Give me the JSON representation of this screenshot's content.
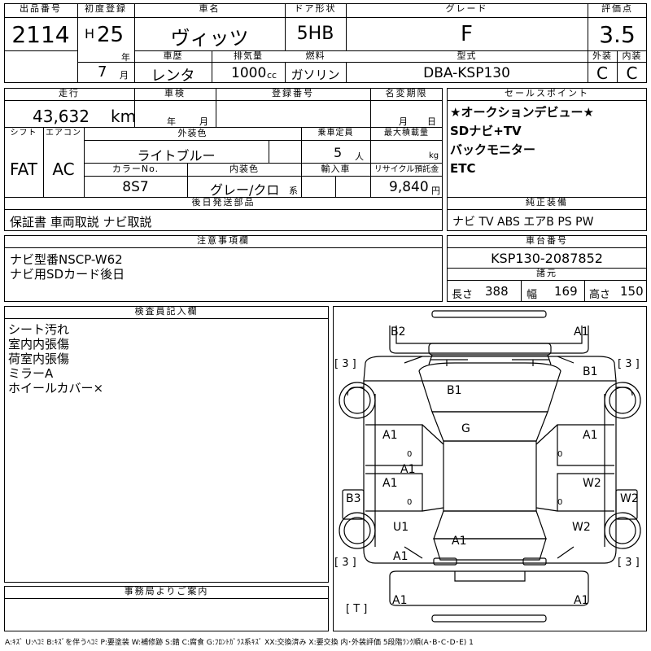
{
  "labels": {
    "lot_no": "出品番号",
    "first_reg": "初度登録",
    "car_name": "車名",
    "door": "ドア形状",
    "grade": "グレード",
    "score": "評価点",
    "history": "車歴",
    "displacement": "排気量",
    "fuel": "燃料",
    "model": "型式",
    "exterior": "外装",
    "interior": "内装",
    "mileage": "走行",
    "inspection": "車検",
    "reg_no": "登録番号",
    "name_change": "名変期限",
    "sales_point": "セールスポイント",
    "shift": "シフト",
    "aircon": "エアコン",
    "ext_color": "外装色",
    "capacity": "乗車定員",
    "max_load": "最大積載量",
    "color_no": "カラーNo.",
    "int_color": "内装色",
    "import": "輸入車",
    "recycle": "リサイクル預託金",
    "later_parts": "後日発送部品",
    "genuine": "純正装備",
    "notes": "注意事項欄",
    "chassis": "車台番号",
    "specs": "諸元",
    "length": "長さ",
    "width": "幅",
    "height": "高さ",
    "inspector": "検査員記入欄",
    "office": "事務局よりご案内",
    "year_unit": "年",
    "month_unit": "月",
    "km_unit": "km",
    "cc_unit": "cc",
    "person_unit": "人",
    "kg_unit": "kg",
    "yen_unit": "円",
    "kei_unit": "系",
    "h_prefix": "H",
    "insp_year": "年",
    "insp_month": "月",
    "nc_month": "月",
    "nc_day": "日"
  },
  "lot_no": "2114",
  "first_reg_year": "25",
  "first_reg_month": "7",
  "car_name": "ヴィッツ",
  "door": "5HB",
  "grade": "F",
  "score": "3.5",
  "history": "レンタ",
  "displacement": "1000",
  "fuel": "ガソリン",
  "model": "DBA-KSP130",
  "exterior_grade": "C",
  "interior_grade": "C",
  "mileage": "43,632",
  "shift": "FAT",
  "aircon": "AC",
  "ext_color": "ライトブルー",
  "capacity": "5",
  "color_no": "8S7",
  "int_color": "グレー/クロ",
  "recycle": "9,840",
  "sales_points": [
    "★オークションデビュー★",
    "SDナビ+TV",
    "バックモニター",
    "ETC"
  ],
  "later_parts": "保証書 車両取説 ナビ取説",
  "genuine": "ナビ TV ABS エアB PS PW",
  "notes": [
    "ナビ型番NSCP-W62",
    "ナビ用SDカード後日"
  ],
  "chassis": "KSP130-2087852",
  "length": "388",
  "width": "169",
  "height": "150",
  "inspector_notes": [
    "シート汚れ",
    "室内内張傷",
    "荷室内張傷",
    "ミラーA",
    "ホイールカバー×"
  ],
  "car_marks": {
    "b2": "B2",
    "a1_front": "A1",
    "b1_hood": "B1",
    "b1_right": "B1",
    "g": "G",
    "a1_lf": "A1",
    "a1_rf": "A1",
    "a1_center": "A1",
    "a1_lr": "A1",
    "w2_r": "W2",
    "w2_edge": "W2",
    "b3": "B3",
    "u1": "U1",
    "w2_rr": "W2",
    "a1_roof": "A1",
    "a1_lq": "A1",
    "a1_rear_l": "A1",
    "a1_rear_r": "A1",
    "bracket_lf": "[ 3 ]",
    "bracket_rf": "[ 3 ]",
    "bracket_lr": "[ 3 ]",
    "bracket_rr": "[ 3 ]",
    "t": "[ T ]",
    "zero1": "0",
    "zero2": "0",
    "zero3": "0",
    "zero4": "0"
  },
  "legend": "A:ｷｽﾞ U:ﾍｺﾐ B:ｷｽﾞを伴うﾍｺﾐ P:要塗装 W:補修跡 S:錆 C:腐食 G:ﾌﾛﾝﾄｶﾞﾗｽ系ｷｽﾞ XX:交換済み X:要交換 内･外装評価 5段階ﾗﾝｸ順(A･B･C･D･E) 1"
}
